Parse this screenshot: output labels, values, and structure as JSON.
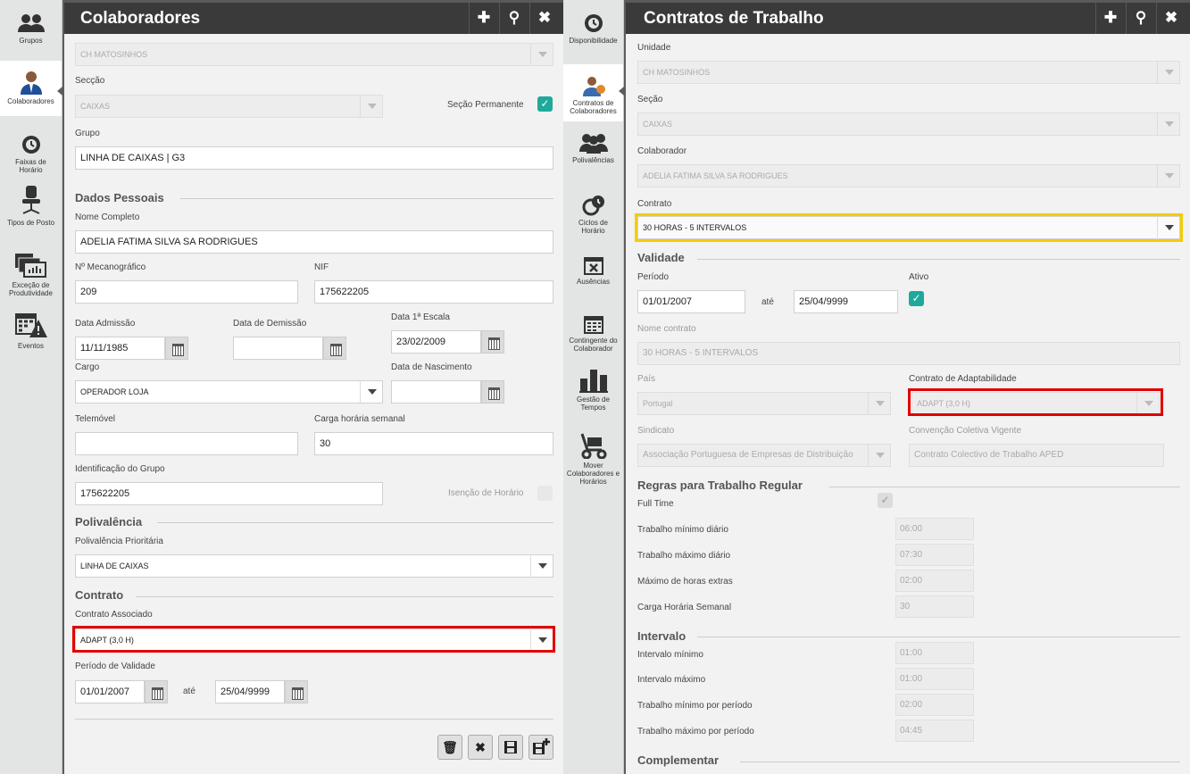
{
  "left_nav": {
    "items": [
      {
        "label": "Grupos",
        "icon": "group-icon"
      },
      {
        "label": "Colaboradores",
        "icon": "user-icon"
      },
      {
        "label": "Faixas de Horário",
        "icon": "clock-icon"
      },
      {
        "label": "Tipos de Posto",
        "icon": "chair-icon"
      },
      {
        "label": "Exceção de Produtividade",
        "icon": "productivity-icon"
      },
      {
        "label": "Eventos",
        "icon": "calendar-warning-icon"
      }
    ]
  },
  "mid_nav": {
    "items": [
      {
        "label": "Disponibilidade",
        "icon": "clock-icon"
      },
      {
        "label": "Contratos de Colaboradores",
        "icon": "contract-user-icon"
      },
      {
        "label": "Polivalências",
        "icon": "group-icon"
      },
      {
        "label": "Ciclos de Horário",
        "icon": "cycle-clock-icon"
      },
      {
        "label": "Ausências",
        "icon": "calendar-x-icon"
      },
      {
        "label": "Contingente do Colaborador",
        "icon": "calendar-icon"
      },
      {
        "label": "Gestão de Tempos",
        "icon": "bar-chart-icon"
      },
      {
        "label": "Mover Colaboradores e Horários",
        "icon": "trolley-icon"
      }
    ]
  },
  "colaboradores": {
    "title": "Colaboradores",
    "buttons": {
      "add": "✚",
      "search": "⚲",
      "close": "✖"
    },
    "unidade_value": "CH MATOSINHOS",
    "seccao_label": "Secção",
    "seccao_value": "CAIXAS",
    "seccao_permanente_label": "Seção Permanente",
    "grupo_label": "Grupo",
    "grupo_value": "LINHA DE CAIXAS | G3",
    "dados_pessoais": "Dados Pessoais",
    "nome_label": "Nome Completo",
    "nome_value": "ADELIA FATIMA SILVA SA RODRIGUES",
    "mecanografico_label": "Nº Mecanográfico",
    "mecanografico_value": "209",
    "nif_label": "NIF",
    "nif_value": "175622205",
    "admissao_label": "Data Admissão",
    "admissao_value": "11/11/1985",
    "demissao_label": "Data de Demissão",
    "demissao_value": "",
    "escala_label": "Data 1ª Escala",
    "escala_value": "23/02/2009",
    "cargo_label": "Cargo",
    "cargo_value": "OPERADOR LOJA",
    "nascimento_label": "Data de Nascimento",
    "nascimento_value": "",
    "telemovel_label": "Telemóvel",
    "telemovel_value": "",
    "carga_label": "Carga horária semanal",
    "carga_value": "30",
    "ident_grupo_label": "Identificação do Grupo",
    "ident_grupo_value": "175622205",
    "isencao_label": "Isenção de Horário",
    "polivalencia": "Polivalência",
    "poli_prio_label": "Polivalência Prioritária",
    "poli_prio_value": "LINHA DE CAIXAS",
    "contrato": "Contrato",
    "contrato_assoc_label": "Contrato Associado",
    "contrato_assoc_value": "ADAPT (3,0 H)",
    "periodo_label": "Período de Validade",
    "periodo_inicio": "01/01/2007",
    "ate": "até",
    "periodo_fim": "25/04/9999"
  },
  "contratos": {
    "title": "Contratos de Trabalho",
    "buttons": {
      "add": "✚",
      "search": "⚲",
      "close": "✖"
    },
    "unidade_label": "Unidade",
    "unidade_value": "CH MATOSINHOS",
    "secao_label": "Seção",
    "secao_value": "CAIXAS",
    "colaborador_label": "Colaborador",
    "colaborador_value": "ADELIA FATIMA SILVA SA RODRIGUES",
    "contrato_label": "Contrato",
    "contrato_value": "30 HORAS - 5 INTERVALOS",
    "validade": "Validade",
    "periodo_label": "Período",
    "periodo_inicio": "01/01/2007",
    "ate": "até",
    "periodo_fim": "25/04/9999",
    "ativo_label": "Ativo",
    "nome_contrato_label": "Nome contrato",
    "nome_contrato_value": "30 HORAS - 5 INTERVALOS",
    "pais_label": "País",
    "pais_value": "Portugal",
    "adapt_label": "Contrato de Adaptabilidade",
    "adapt_value": "ADAPT (3,0 H)",
    "sindicato_label": "Sindicato",
    "sindicato_value": "Associação Portuguesa de Empresas de Distribuição",
    "convencao_label": "Convenção Coletiva Vigente",
    "convencao_value": "Contrato Colectivo de Trabalho APED",
    "regras": "Regras para Trabalho Regular",
    "full_time_label": "Full Time",
    "regras_rows": [
      {
        "label": "Trabalho mínimo diário",
        "value": "06:00"
      },
      {
        "label": "Trabalho máximo diário",
        "value": "07:30"
      },
      {
        "label": "Máximo de horas extras",
        "value": "02:00"
      },
      {
        "label": "Carga Horária Semanal",
        "value": "30"
      }
    ],
    "intervalo": "Intervalo",
    "intervalo_rows": [
      {
        "label": "Intervalo mínimo",
        "value": "01:00"
      },
      {
        "label": "Intervalo máximo",
        "value": "01:00"
      },
      {
        "label": "Trabalho mínimo por período",
        "value": "02:00"
      },
      {
        "label": "Trabalho máximo por período",
        "value": "04:45"
      }
    ],
    "complementar": "Complementar"
  },
  "colors": {
    "accent_teal": "#1ea99a",
    "highlight_red": "#e00000",
    "highlight_yellow": "#f5cc00",
    "header": "#3a3a3a"
  }
}
